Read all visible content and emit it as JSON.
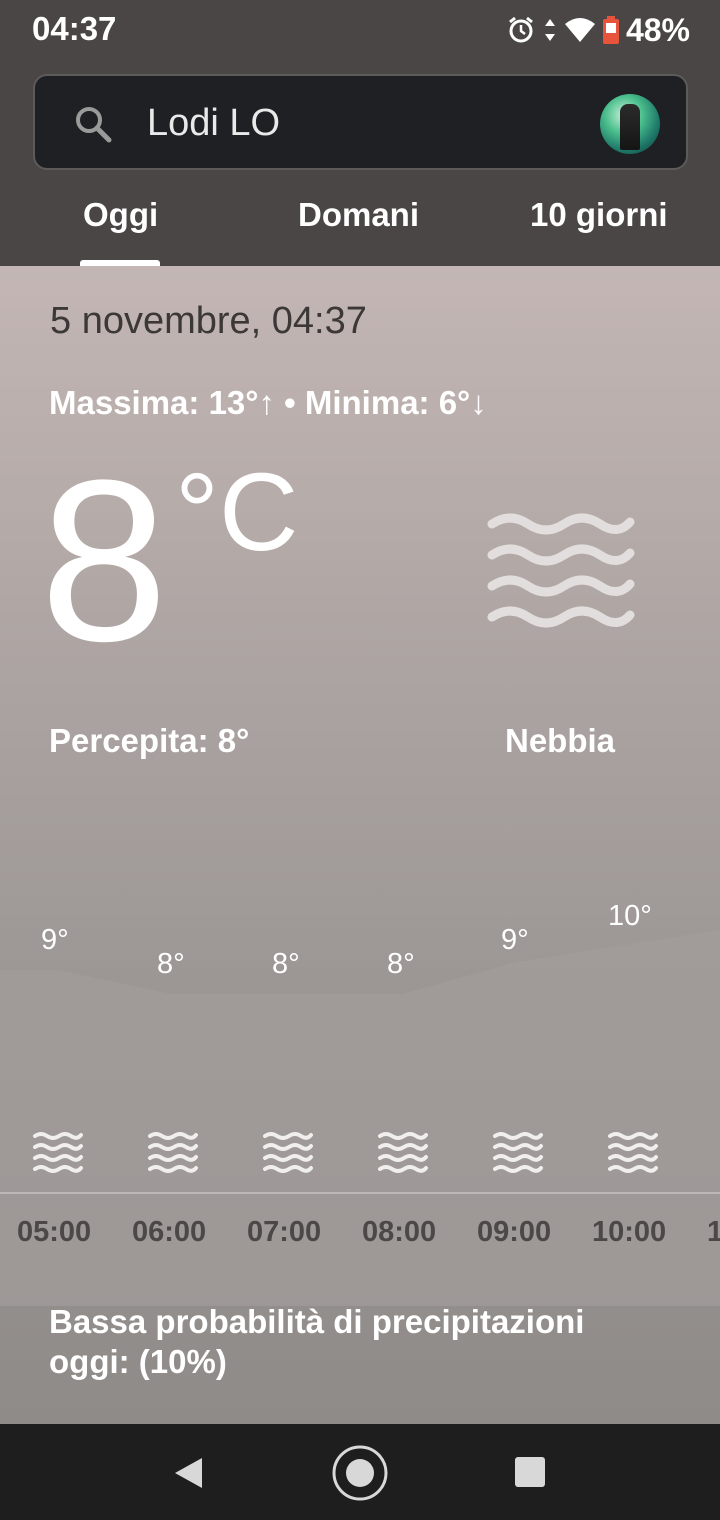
{
  "status_bar": {
    "time": "04:37",
    "battery": "48%",
    "icons": [
      "alarm-icon",
      "data-arrows-icon",
      "wifi-icon",
      "battery-saver-icon"
    ]
  },
  "search": {
    "location": "Lodi LO",
    "icon": "search-icon"
  },
  "tabs": [
    {
      "label": "Oggi",
      "selected": true
    },
    {
      "label": "Domani",
      "selected": false
    },
    {
      "label": "10 giorni",
      "selected": false
    }
  ],
  "current": {
    "date": "5 novembre, 04:37",
    "maxmin": "Massima: 13°↑ • Minima: 6°↓",
    "temperature": "8",
    "unit": "°C",
    "feels_like": "Percepita: 8°",
    "condition": "Nebbia",
    "condition_icon": "fog-icon"
  },
  "hourly": [
    {
      "time": "05:00",
      "temp": "9°"
    },
    {
      "time": "06:00",
      "temp": "8°"
    },
    {
      "time": "07:00",
      "temp": "8°"
    },
    {
      "time": "08:00",
      "temp": "8°"
    },
    {
      "time": "09:00",
      "temp": "9°"
    },
    {
      "time": "10:00",
      "temp": "10°"
    },
    {
      "time": "1"
    }
  ],
  "precipitation": "Bassa probabilità di precipitazioni oggi: (10%)",
  "colors": {
    "header_bg": "#4a4646",
    "search_bg": "#1f2023",
    "nav_bg": "#1e1e1e"
  }
}
